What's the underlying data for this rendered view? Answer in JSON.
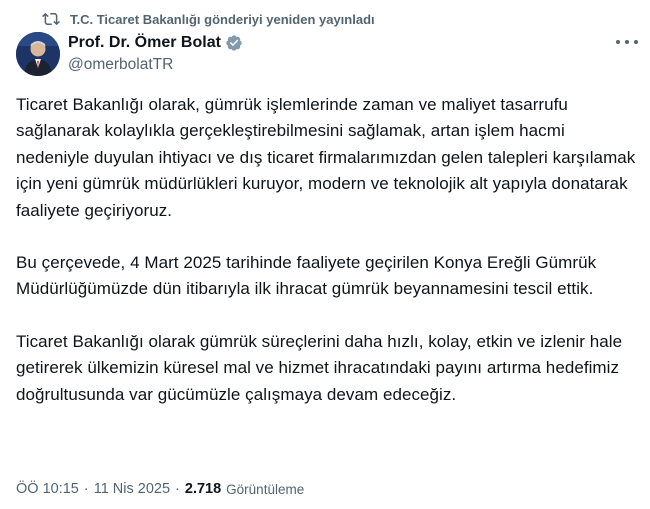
{
  "repost": {
    "text": "T.C. Ticaret Bakanlığı gönderiyi yeniden yayınladı"
  },
  "author": {
    "name": "Prof. Dr. Ömer Bolat",
    "handle": "@omerbolatTR",
    "verified": true
  },
  "icons": {
    "repost": "repost-icon",
    "verified": "verified-badge-icon",
    "more": "more-options-icon",
    "avatar": "avatar"
  },
  "colors": {
    "text": "#0f1419",
    "secondary": "#536471",
    "verified_badge": "#829aab"
  },
  "tweet": {
    "paragraphs": [
      "Ticaret Bakanlığı olarak, gümrük işlemlerinde zaman ve maliyet tasarrufu sağlanarak kolaylıkla gerçekleştirebilmesini sağlamak, artan işlem hacmi nedeniyle duyulan ihtiyacı ve dış ticaret firmalarımızdan gelen talepleri karşılamak için yeni gümrük müdürlükleri kuruyor, modern ve teknolojik alt yapıyla donatarak faaliyete geçiriyoruz.",
      "Bu çerçevede, 4 Mart 2025 tarihinde faaliyete geçirilen Konya Ereğli Gümrük Müdürlüğümüzde dün itibarıyla ilk ihracat gümrük beyannamesini tescil ettik.",
      "Ticaret Bakanlığı olarak gümrük süreçlerini daha hızlı, kolay, etkin ve izlenir hale getirerek ülkemizin küresel mal ve hizmet ihracatındaki payını artırma hedefimiz doğrultusunda var gücümüzle çalışmaya devam edeceğiz."
    ]
  },
  "meta": {
    "time": "ÖÖ 10:15",
    "separator": "·",
    "date": "11 Nis 2025",
    "views_count": "2.718",
    "views_label": "Görüntüleme"
  }
}
